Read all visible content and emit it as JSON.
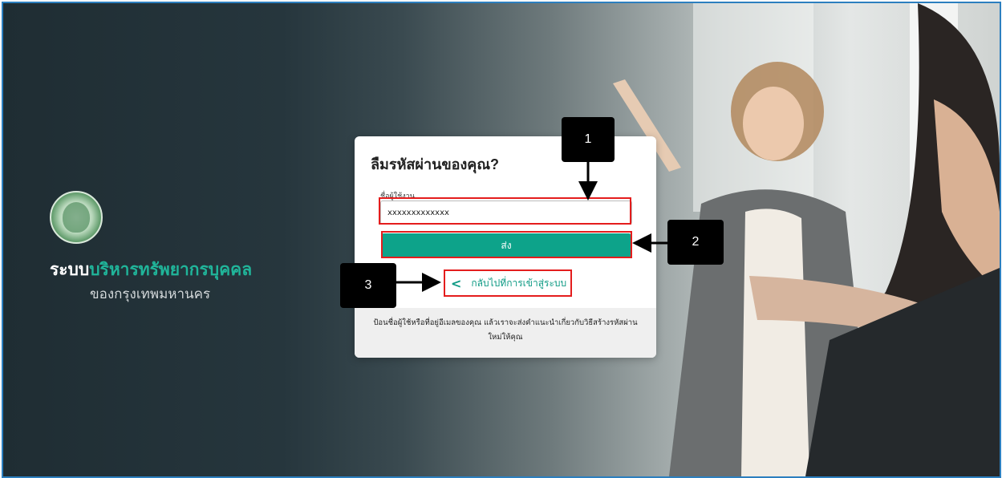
{
  "brand": {
    "title_part1": "ระบบ",
    "title_part2": "บริหารทรัพยากรบุคคล",
    "subtitle": "ของกรุงเทพมหานคร"
  },
  "form": {
    "title": "ลืมรหัสผ่านของคุณ?",
    "username_label": "ชื่อผู้ใช้งาน",
    "username_value": "xxxxxxxxxxxxx",
    "submit_label": "ส่ง",
    "back_link_label": "กลับไปที่การเข้าสู่ระบบ",
    "back_link_icon": "chevron-left-icon",
    "footer_text": "ป้อนชื่อผู้ใช้หรือที่อยู่อีเมลของคุณ แล้วเราจะส่งคำแนะนำเกี่ยวกับวิธีสร้างรหัสผ่านใหม่ให้คุณ"
  },
  "annotations": {
    "callout_1": "1",
    "callout_2": "2",
    "callout_3": "3"
  },
  "colors": {
    "accent": "#0da38a",
    "brand_green": "#20b59a",
    "highlight": "#e41d1d",
    "frame": "#2c7fbf"
  }
}
